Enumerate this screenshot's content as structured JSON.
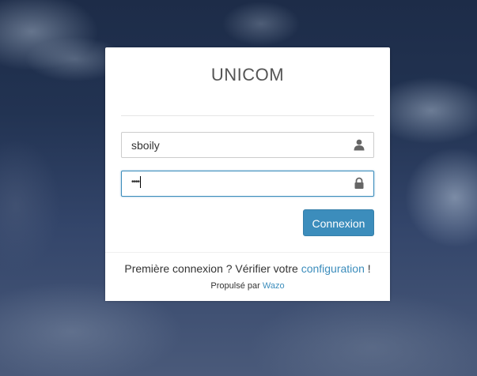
{
  "login": {
    "title": "UNICOM",
    "username_value": "sboily",
    "password_value": "••••",
    "submit_label": "Connexion"
  },
  "footer": {
    "first_login_text": "Première connexion ? Vérifier votre ",
    "config_link": "configuration",
    "first_login_suffix": " !",
    "powered_by_text": "Propulsé par ",
    "powered_by_link": "Wazo"
  },
  "colors": {
    "accent": "#3c8dbc",
    "card": "#ffffff"
  },
  "icons": {
    "username": "user-icon",
    "password": "lock-icon"
  }
}
